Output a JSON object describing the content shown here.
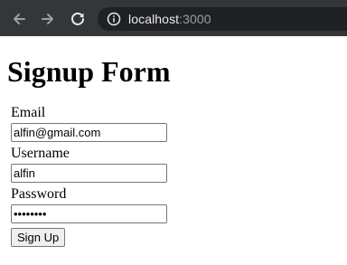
{
  "browser": {
    "url_host": "localhost",
    "url_port": ":3000",
    "icons": {
      "back": "back-arrow-icon",
      "forward": "forward-arrow-icon",
      "reload": "reload-icon",
      "site_info": "info-icon"
    }
  },
  "page": {
    "title": "Signup Form",
    "form": {
      "email_label": "Email",
      "email_value": "alfin@gmail.com",
      "username_label": "Username",
      "username_value": "alfin",
      "password_label": "Password",
      "password_value": "••••••••",
      "submit_label": "Sign Up"
    }
  }
}
